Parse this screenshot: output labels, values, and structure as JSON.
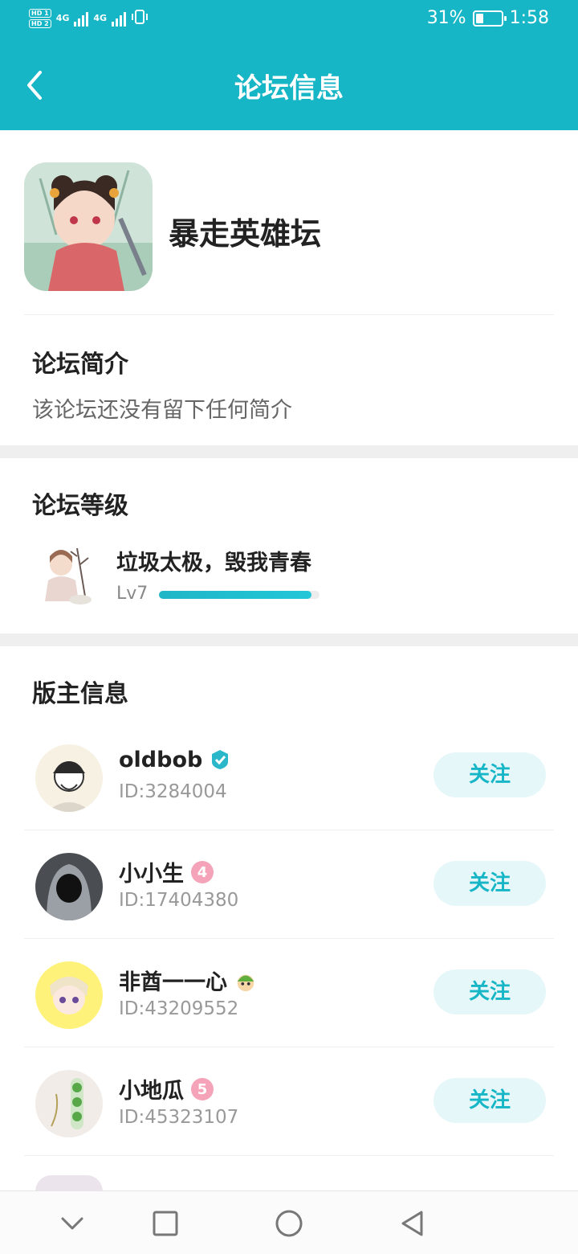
{
  "status_bar": {
    "hd1": "HD 1",
    "hd2": "HD 2",
    "net1": "4G",
    "net2": "4G",
    "battery_percent": "31%",
    "battery_level": 0.31,
    "time": "1:58"
  },
  "header": {
    "title": "论坛信息",
    "back_icon": "chevron-left-icon"
  },
  "forum": {
    "name": "暴走英雄坛"
  },
  "intro": {
    "heading": "论坛简介",
    "text": "该论坛还没有留下任何简介"
  },
  "level": {
    "heading": "论坛等级",
    "name": "垃圾太极，毁我青春",
    "label": "Lv7",
    "progress": 0.95
  },
  "moderators": {
    "heading": "版主信息",
    "items": [
      {
        "name": "oldbob",
        "id": "ID:3284004",
        "badge": "verified-icon",
        "follow": "关注"
      },
      {
        "name": "小小生",
        "id": "ID:17404380",
        "badge": "level-4-badge",
        "follow": "关注"
      },
      {
        "name": "非酋一一心",
        "id": "ID:43209552",
        "badge": "character-badge",
        "follow": "关注"
      },
      {
        "name": "小地瓜",
        "id": "ID:45323107",
        "badge": "level-5-badge",
        "follow": "关注"
      }
    ]
  },
  "nav": {
    "items": [
      "chevron-down-icon",
      "square-icon",
      "circle-icon",
      "triangle-back-icon"
    ]
  },
  "colors": {
    "accent": "#17b6c6",
    "follow_bg": "#e6f7f9",
    "divider": "#efefef"
  }
}
